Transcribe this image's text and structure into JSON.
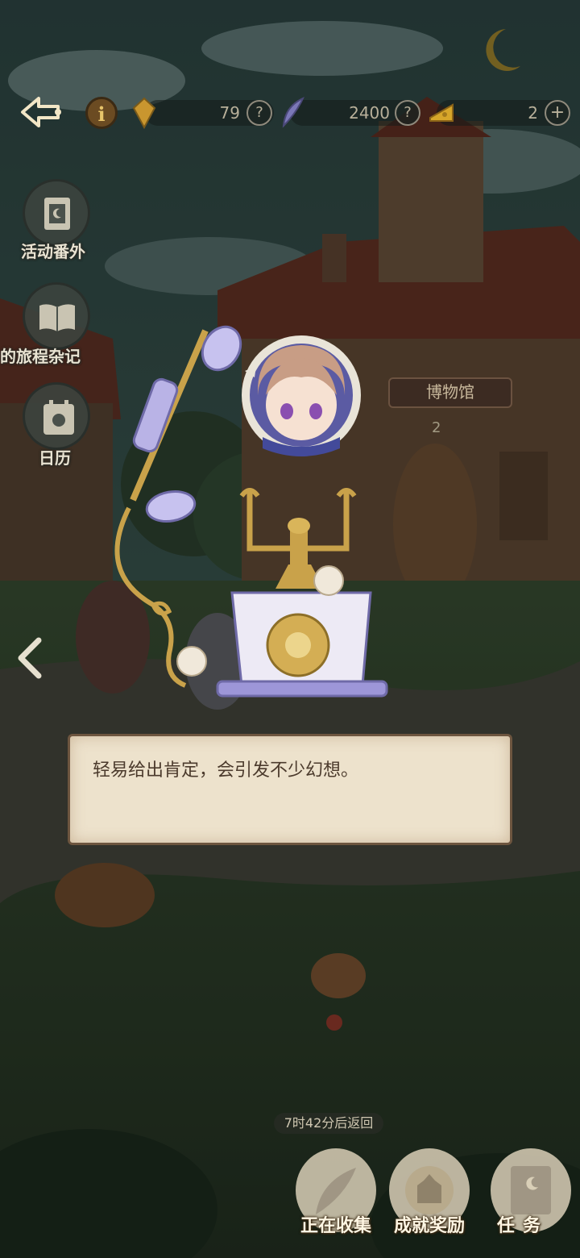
{
  "resources": {
    "crystal_count": "79",
    "feather_count": "2400",
    "cheese_count": "2",
    "help_mark": "?",
    "add_mark": "+"
  },
  "info_button": "i",
  "side_menu": [
    {
      "label": "活动番外",
      "icon": "film-icon"
    },
    {
      "label": "的旅程杂记",
      "icon": "book-icon"
    },
    {
      "label": "日历",
      "icon": "calendar-icon"
    }
  ],
  "building": {
    "label": "博物馆",
    "count": "2"
  },
  "dialog": {
    "text": "轻易给出肯定，会引发不少幻想。"
  },
  "timer": "7时42分后返回",
  "bottom_nav": [
    {
      "label": "正在收集",
      "icon": "feather-icon"
    },
    {
      "label": "成就奖励",
      "icon": "castle-seal-icon"
    },
    {
      "label": "任务",
      "icon": "quest-book-icon"
    }
  ],
  "colors": {
    "dialog_bg": "#ede2cc",
    "phone_lavender": "#b9b3e6",
    "gold": "#c9a24a"
  }
}
